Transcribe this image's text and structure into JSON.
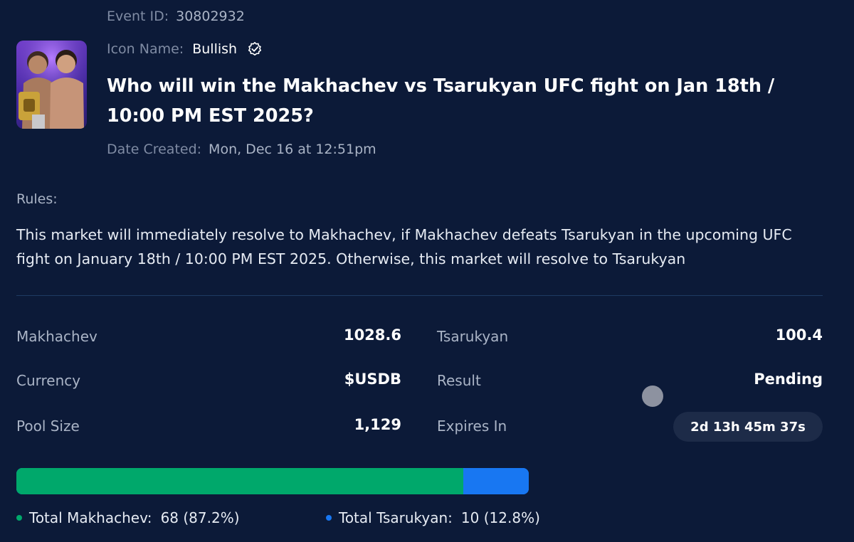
{
  "event": {
    "id_label": "Event ID:",
    "id_value": "30802932",
    "icon_label": "Icon Name:",
    "icon_value": "Bullish",
    "title": "Who will win the Makhachev vs Tsarukyan UFC fight on Jan 18th / 10:00 PM EST 2025?",
    "date_label": "Date Created:",
    "date_value": "Mon, Dec 16 at 12:51pm"
  },
  "rules": {
    "label": "Rules:",
    "text": "This market will immediately resolve to Makhachev, if Makhachev defeats Tsarukyan in the upcoming UFC fight on January 18th / 10:00 PM EST 2025. Otherwise, this market will resolve to Tsarukyan"
  },
  "stats": {
    "makhachev_label": "Makhachev",
    "makhachev_value": "1028.6",
    "tsarukyan_label": "Tsarukyan",
    "tsarukyan_value": "100.4",
    "currency_label": "Currency",
    "currency_value": "$USDB",
    "result_label": "Result",
    "result_value": "Pending",
    "pool_label": "Pool Size",
    "pool_value": "1,129",
    "expires_label": "Expires In",
    "expires_value": "2d 13h 45m 37s"
  },
  "totals": {
    "makhachev_label": "Total Makhachev:",
    "makhachev_value": "68 (87.2%)",
    "makhachev_fraction": 0.872,
    "tsarukyan_label": "Total Tsarukyan:",
    "tsarukyan_value": "10 (12.8%)",
    "tsarukyan_fraction": 0.128
  },
  "colors": {
    "background": "#0c1a38",
    "makhachev_green": "#00a86b",
    "tsarukyan_blue": "#1877f2"
  },
  "icons": {
    "verified": "verified-badge-icon"
  }
}
